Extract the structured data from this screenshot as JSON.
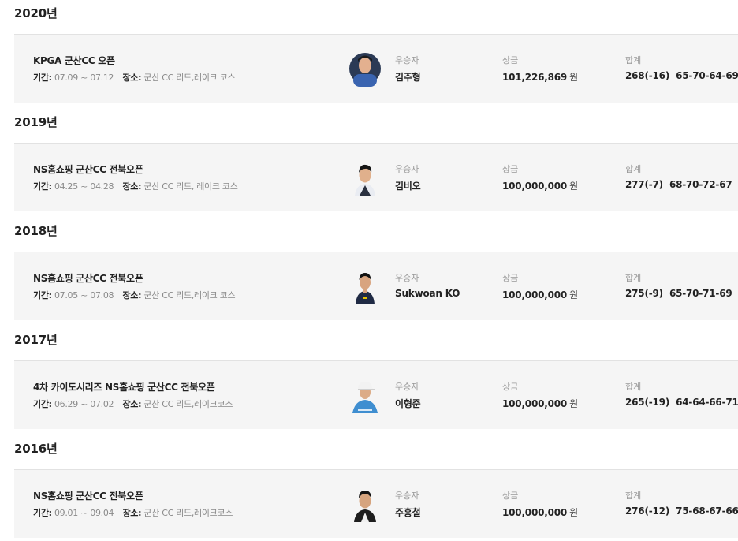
{
  "years": [
    {
      "year": "2020년",
      "tournament": "KPGA 군산CC 오픈",
      "period_label": "기간:",
      "period": "07.09 ~ 07.12",
      "venue_label": "장소:",
      "venue": "군산 CC 리드,레이크 코스",
      "winner_label": "우승자",
      "winner": "김주형",
      "prize_label": "상금",
      "prize": "101,226,869",
      "prize_unit": "원",
      "total_label": "합계",
      "total": "268(-16)",
      "rounds": "65-70-64-69",
      "avatar_icon": "golfer-portrait-icon"
    },
    {
      "year": "2019년",
      "tournament": "NS홈쇼핑 군산CC 전북오픈",
      "period_label": "기간:",
      "period": "04.25 ~ 04.28",
      "venue_label": "장소:",
      "venue": "군산 CC 리드, 레이크 코스",
      "winner_label": "우승자",
      "winner": "김비오",
      "prize_label": "상금",
      "prize": "100,000,000",
      "prize_unit": "원",
      "total_label": "합계",
      "total": "277(-7)",
      "rounds": "68-70-72-67",
      "avatar_icon": "golfer-portrait-icon"
    },
    {
      "year": "2018년",
      "tournament": "NS홈쇼핑 군산CC 전북오픈",
      "period_label": "기간:",
      "period": "07.05 ~ 07.08",
      "venue_label": "장소:",
      "venue": "군산 CC 리드,레이크 코스",
      "winner_label": "우승자",
      "winner": "Sukwoan KO",
      "prize_label": "상금",
      "prize": "100,000,000",
      "prize_unit": "원",
      "total_label": "합계",
      "total": "275(-9)",
      "rounds": "65-70-71-69",
      "avatar_icon": "golfer-portrait-icon"
    },
    {
      "year": "2017년",
      "tournament": "4차 카이도시리즈 NS홈쇼핑 군산CC 전북오픈",
      "period_label": "기간:",
      "period": "06.29 ~ 07.02",
      "venue_label": "장소:",
      "venue": "군산 CC 리드,레이크코스",
      "winner_label": "우승자",
      "winner": "이형준",
      "prize_label": "상금",
      "prize": "100,000,000",
      "prize_unit": "원",
      "total_label": "합계",
      "total": "265(-19)",
      "rounds": "64-64-66-71",
      "avatar_icon": "golfer-portrait-icon"
    },
    {
      "year": "2016년",
      "tournament": "NS홈쇼핑 군산CC 전북오픈",
      "period_label": "기간:",
      "period": "09.01 ~ 09.04",
      "venue_label": "장소:",
      "venue": "군산 CC 리드,레이크코스",
      "winner_label": "우승자",
      "winner": "주흥철",
      "prize_label": "상금",
      "prize": "100,000,000",
      "prize_unit": "원",
      "total_label": "합계",
      "total": "276(-12)",
      "rounds": "75-68-67-66",
      "avatar_icon": "golfer-portrait-icon"
    }
  ],
  "colors": {
    "card_bg": "#f5f5f5",
    "divider": "#e2e2e2",
    "label": "#999999",
    "meta": "#8a8a8a",
    "text": "#222222"
  }
}
